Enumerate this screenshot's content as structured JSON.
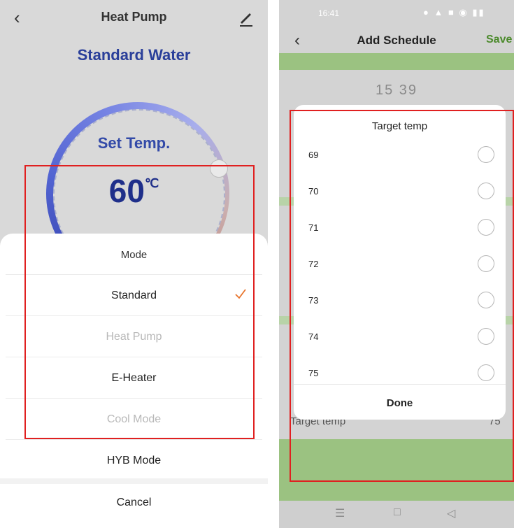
{
  "left_screen": {
    "header_title": "Heat Pump",
    "mode_title": "Standard Water",
    "set_temp_label": "Set Temp.",
    "set_temp_value": "60",
    "set_temp_unit": "℃",
    "sheet": {
      "title": "Mode",
      "options": [
        {
          "label": "Standard",
          "selected": true,
          "enabled": true
        },
        {
          "label": "Heat Pump",
          "selected": false,
          "enabled": false
        },
        {
          "label": "E-Heater",
          "selected": false,
          "enabled": true
        },
        {
          "label": "Cool Mode",
          "selected": false,
          "enabled": false
        },
        {
          "label": "HYB Mode",
          "selected": false,
          "enabled": true
        }
      ],
      "cancel_label": "Cancel"
    }
  },
  "right_screen": {
    "status_time": "16:41",
    "header_title": "Add Schedule",
    "save_label": "Save",
    "time_value": "15  39",
    "background_row_label": "Target temp",
    "background_row_value": "75",
    "dialog": {
      "title": "Target temp",
      "options": [
        "69",
        "70",
        "71",
        "72",
        "73",
        "74",
        "75"
      ],
      "done_label": "Done"
    }
  },
  "colors": {
    "accent_check": "#e8742c",
    "save_green": "#4b8a2b",
    "highlight_red": "#e02020",
    "dial_blue": "#1f2fae"
  }
}
